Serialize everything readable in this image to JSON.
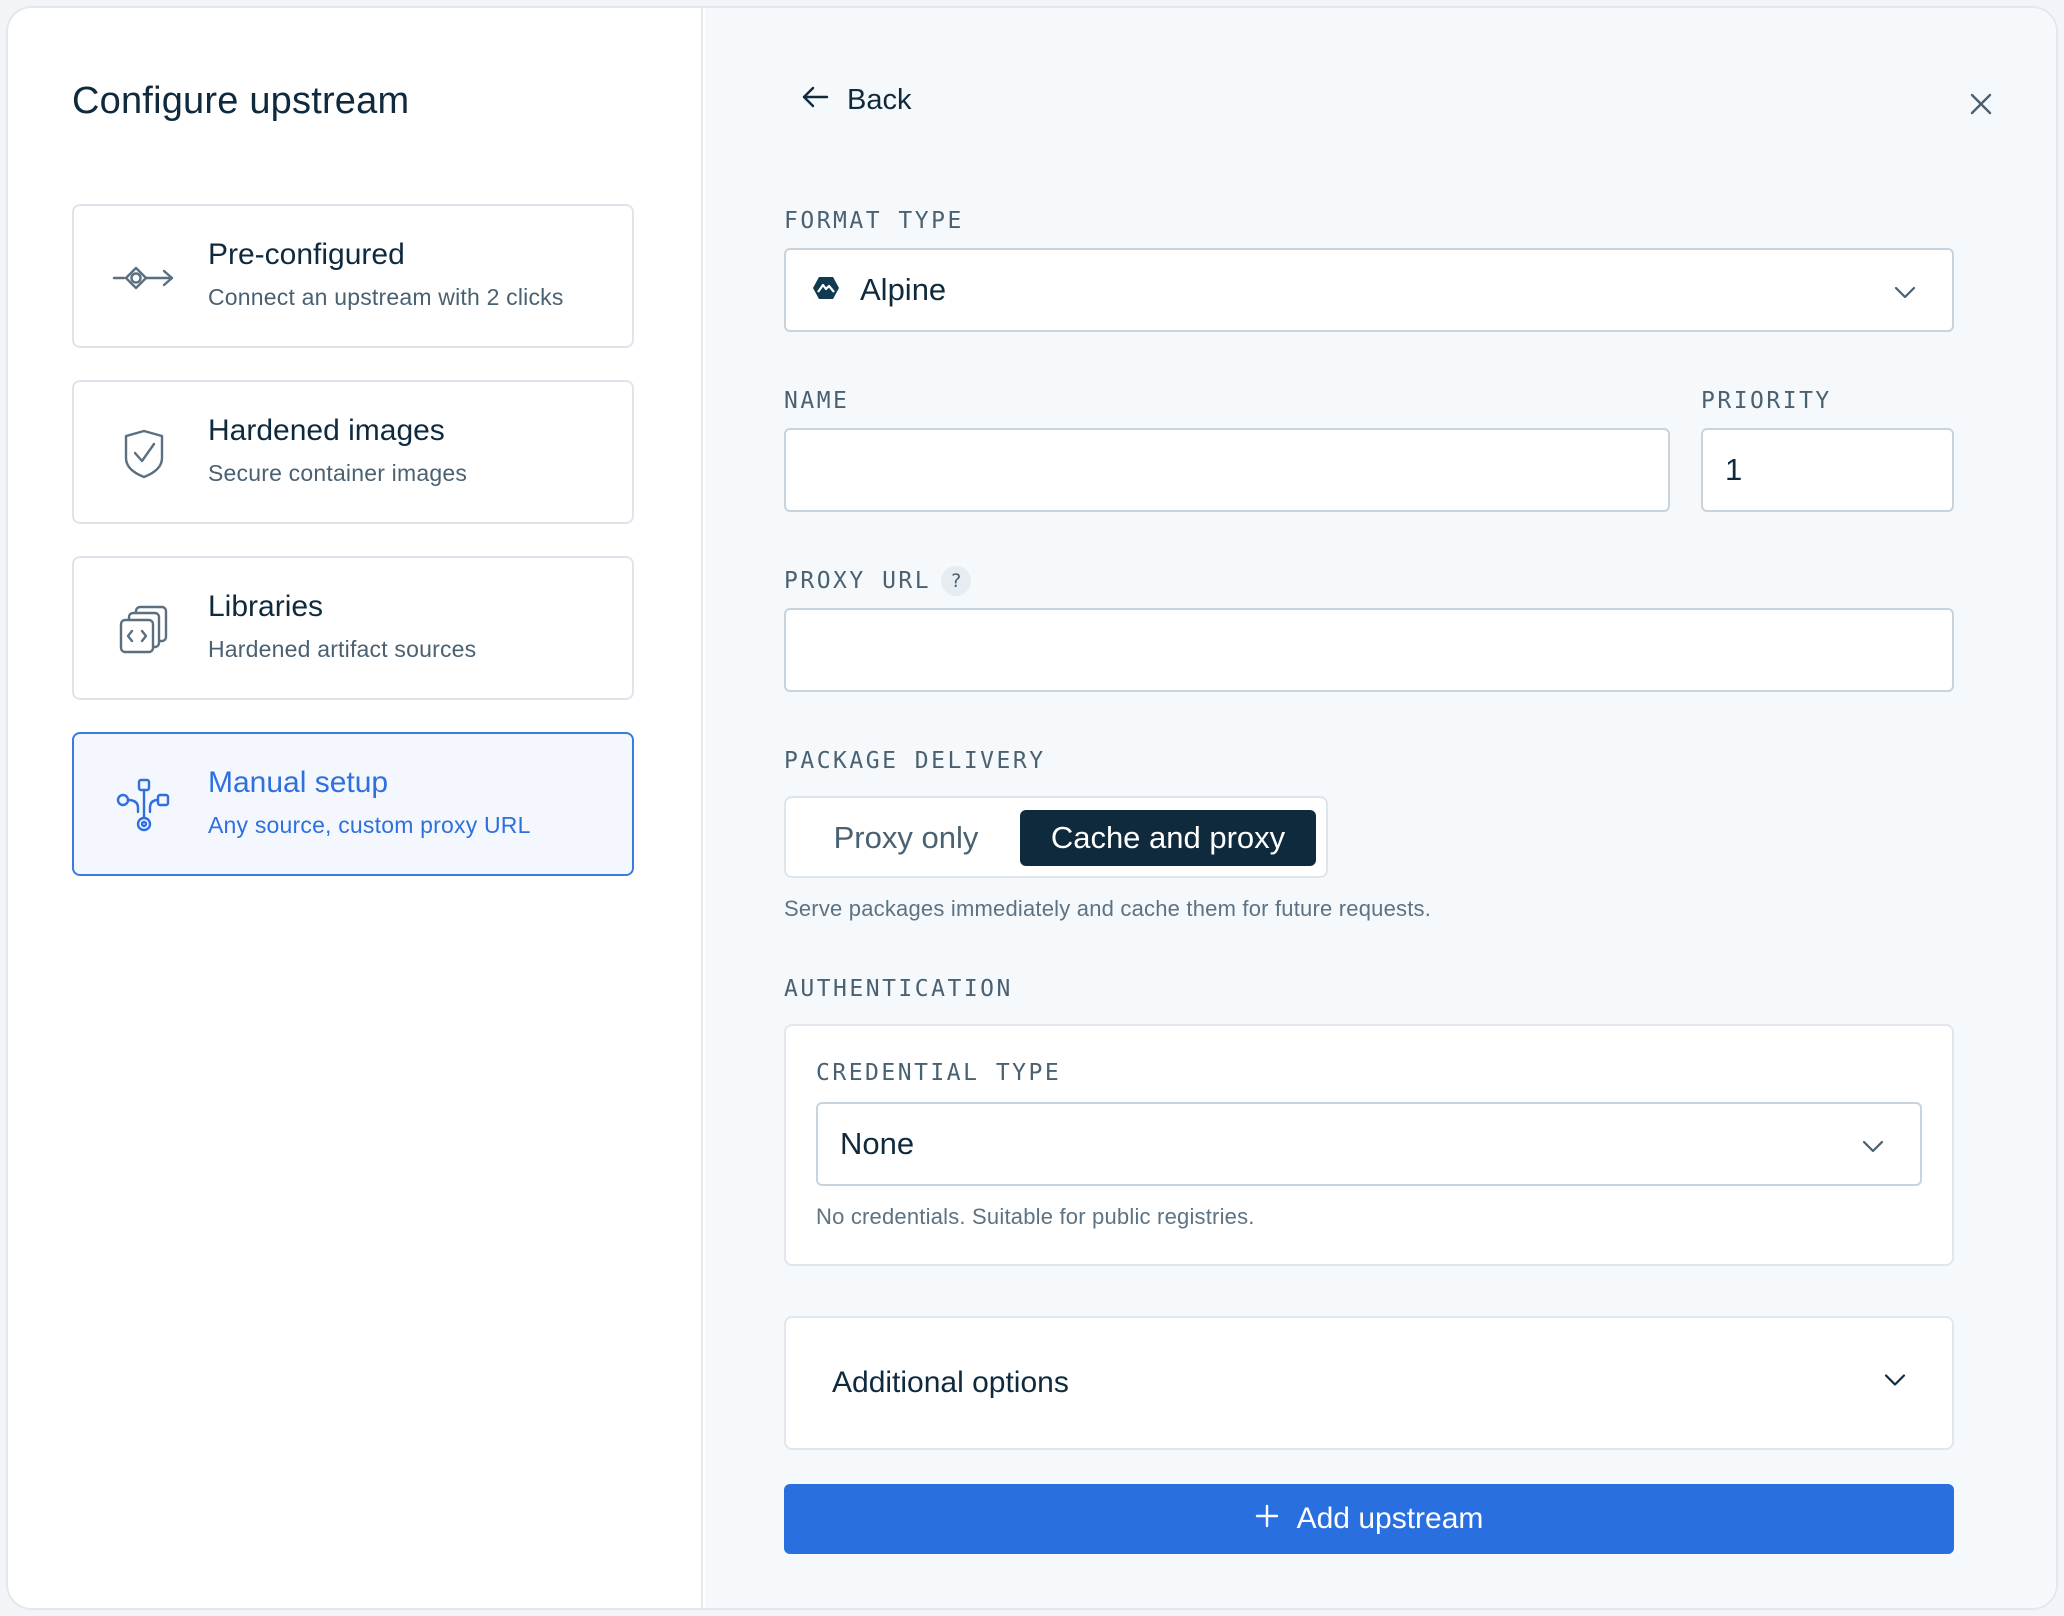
{
  "sidebar": {
    "title": "Configure upstream",
    "options": [
      {
        "title": "Pre-configured",
        "subtitle": "Connect an upstream with 2 clicks",
        "icon": "node-arrow-icon",
        "selected": false
      },
      {
        "title": "Hardened images",
        "subtitle": "Secure container images",
        "icon": "shield-check-icon",
        "selected": false
      },
      {
        "title": "Libraries",
        "subtitle": "Hardened artifact sources",
        "icon": "code-stack-icon",
        "selected": false
      },
      {
        "title": "Manual setup",
        "subtitle": "Any source, custom proxy URL",
        "icon": "network-branch-icon",
        "selected": true
      }
    ]
  },
  "header": {
    "back_label": "Back"
  },
  "form": {
    "format_type": {
      "label": "FORMAT TYPE",
      "value": "Alpine",
      "icon": "alpine-logo-icon"
    },
    "name": {
      "label": "NAME",
      "value": ""
    },
    "priority": {
      "label": "PRIORITY",
      "value": "1"
    },
    "proxy_url": {
      "label": "PROXY URL",
      "help": "?",
      "value": ""
    },
    "package_delivery": {
      "label": "PACKAGE DELIVERY",
      "options": [
        "Proxy only",
        "Cache and proxy"
      ],
      "selected": "Cache and proxy",
      "hint": "Serve packages immediately and cache them for future requests."
    },
    "authentication": {
      "label": "AUTHENTICATION",
      "credential_type": {
        "label": "CREDENTIAL TYPE",
        "value": "None",
        "hint": "No credentials. Suitable for public registries."
      }
    },
    "additional_options": {
      "label": "Additional options"
    },
    "submit_label": "Add upstream"
  },
  "colors": {
    "accent": "#2a6fe0",
    "dark": "#0f2a3d",
    "selected_border": "#3a7be3"
  }
}
